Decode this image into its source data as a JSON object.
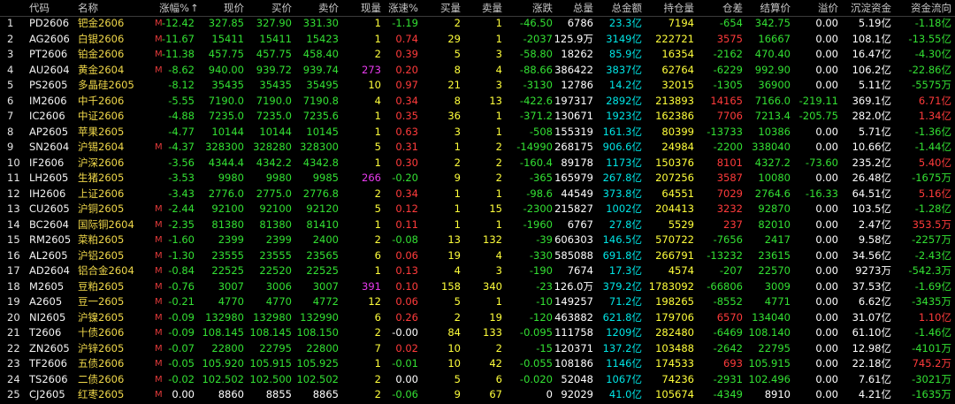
{
  "colors": {
    "up": "#ff3b3b",
    "down": "#33e033",
    "neutral": "#ffffff",
    "code": "#f2f2f2",
    "name": "#f0d84a",
    "cyan": "#00e5e5",
    "yellow": "#ffff3b",
    "volume_purple": "#e83aee",
    "m_mark": "#e23a3a"
  },
  "header": {
    "columns": [
      "",
      "代码",
      "名称",
      "",
      "涨幅%",
      "现价",
      "买价",
      "卖价",
      "现量",
      "涨速%",
      "买量",
      "卖量",
      "涨跌",
      "总量",
      "总金额",
      "持仓量",
      "仓差",
      "结算价",
      "溢价",
      "沉淀资金",
      "资金流向"
    ],
    "sort_indicator": "↑"
  },
  "rows": [
    {
      "idx": "1",
      "code": "PD2606",
      "name": "钯金2606",
      "mark": "M",
      "chg": "-12.42",
      "price": "327.85",
      "bid": "327.90",
      "ask": "331.30",
      "curvol": "1",
      "speed": "-1.19",
      "bidvol": "2",
      "askvol": "1",
      "diff": "-46.50",
      "vol": "6786",
      "amount": "23.3亿",
      "oi": "7194",
      "oidiff": "-654",
      "settle": "342.75",
      "premium": "0.00",
      "sunk": "5.19亿",
      "flow": "-1.18亿"
    },
    {
      "idx": "2",
      "code": "AG2606",
      "name": "白银2606",
      "mark": "M",
      "chg": "-11.67",
      "price": "15411",
      "bid": "15411",
      "ask": "15423",
      "curvol": "1",
      "speed": "0.74",
      "bidvol": "29",
      "askvol": "1",
      "diff": "-2037",
      "vol": "125.9万",
      "amount": "3149亿",
      "oi": "222721",
      "oidiff": "3575",
      "settle": "16667",
      "premium": "0.00",
      "sunk": "108.1亿",
      "flow": "-13.55亿"
    },
    {
      "idx": "3",
      "code": "PT2606",
      "name": "铂金2606",
      "mark": "M",
      "chg": "-11.38",
      "price": "457.75",
      "bid": "457.75",
      "ask": "458.40",
      "curvol": "2",
      "speed": "0.39",
      "bidvol": "5",
      "askvol": "3",
      "diff": "-58.80",
      "vol": "18262",
      "amount": "85.9亿",
      "oi": "16354",
      "oidiff": "-2162",
      "settle": "470.40",
      "premium": "0.00",
      "sunk": "16.47亿",
      "flow": "-4.30亿"
    },
    {
      "idx": "4",
      "code": "AU2604",
      "name": "黄金2604",
      "mark": "M",
      "chg": "-8.62",
      "price": "940.00",
      "bid": "939.72",
      "ask": "939.74",
      "curvol": "273",
      "speed": "0.20",
      "bidvol": "8",
      "askvol": "4",
      "diff": "-88.66",
      "vol": "386422",
      "amount": "3837亿",
      "oi": "62764",
      "oidiff": "-6229",
      "settle": "992.90",
      "premium": "0.00",
      "sunk": "106.2亿",
      "flow": "-22.86亿"
    },
    {
      "idx": "5",
      "code": "PS2605",
      "name": "多晶硅2605",
      "mark": "",
      "chg": "-8.12",
      "price": "35435",
      "bid": "35435",
      "ask": "35495",
      "curvol": "10",
      "speed": "0.97",
      "bidvol": "21",
      "askvol": "3",
      "diff": "-3130",
      "vol": "12786",
      "amount": "14.2亿",
      "oi": "32015",
      "oidiff": "-1305",
      "settle": "36900",
      "premium": "0.00",
      "sunk": "5.11亿",
      "flow": "-5575万"
    },
    {
      "idx": "6",
      "code": "IM2606",
      "name": "中千2606",
      "mark": "",
      "chg": "-5.55",
      "price": "7190.0",
      "bid": "7190.0",
      "ask": "7190.8",
      "curvol": "4",
      "speed": "0.34",
      "bidvol": "8",
      "askvol": "13",
      "diff": "-422.6",
      "vol": "197317",
      "amount": "2892亿",
      "oi": "213893",
      "oidiff": "14165",
      "settle": "7166.0",
      "premium": "-219.11",
      "sunk": "369.1亿",
      "flow": "6.71亿"
    },
    {
      "idx": "7",
      "code": "IC2606",
      "name": "中证2606",
      "mark": "",
      "chg": "-4.88",
      "price": "7235.0",
      "bid": "7235.0",
      "ask": "7235.6",
      "curvol": "1",
      "speed": "0.35",
      "bidvol": "36",
      "askvol": "1",
      "diff": "-371.2",
      "vol": "130671",
      "amount": "1923亿",
      "oi": "162386",
      "oidiff": "7706",
      "settle": "7213.4",
      "premium": "-205.75",
      "sunk": "282.0亿",
      "flow": "1.34亿"
    },
    {
      "idx": "8",
      "code": "AP2605",
      "name": "苹果2605",
      "mark": "",
      "chg": "-4.77",
      "price": "10144",
      "bid": "10144",
      "ask": "10145",
      "curvol": "1",
      "speed": "0.63",
      "bidvol": "3",
      "askvol": "1",
      "diff": "-508",
      "vol": "155319",
      "amount": "161.3亿",
      "oi": "80399",
      "oidiff": "-13733",
      "settle": "10386",
      "premium": "0.00",
      "sunk": "5.71亿",
      "flow": "-1.36亿"
    },
    {
      "idx": "9",
      "code": "SN2604",
      "name": "沪锡2604",
      "mark": "M",
      "chg": "-4.37",
      "price": "328300",
      "bid": "328280",
      "ask": "328300",
      "curvol": "5",
      "speed": "0.31",
      "bidvol": "1",
      "askvol": "2",
      "diff": "-14990",
      "vol": "268175",
      "amount": "906.6亿",
      "oi": "24984",
      "oidiff": "-2200",
      "settle": "338040",
      "premium": "0.00",
      "sunk": "10.66亿",
      "flow": "-1.44亿"
    },
    {
      "idx": "10",
      "code": "IF2606",
      "name": "沪深2606",
      "mark": "",
      "chg": "-3.56",
      "price": "4344.4",
      "bid": "4342.2",
      "ask": "4342.8",
      "curvol": "1",
      "speed": "0.30",
      "bidvol": "2",
      "askvol": "2",
      "diff": "-160.4",
      "vol": "89178",
      "amount": "1173亿",
      "oi": "150376",
      "oidiff": "8101",
      "settle": "4327.2",
      "premium": "-73.60",
      "sunk": "235.2亿",
      "flow": "5.40亿"
    },
    {
      "idx": "11",
      "code": "LH2605",
      "name": "生猪2605",
      "mark": "",
      "chg": "-3.53",
      "price": "9980",
      "bid": "9980",
      "ask": "9985",
      "curvol": "266",
      "speed": "-0.20",
      "bidvol": "9",
      "askvol": "2",
      "diff": "-365",
      "vol": "165979",
      "amount": "267.8亿",
      "oi": "207256",
      "oidiff": "3587",
      "settle": "10080",
      "premium": "0.00",
      "sunk": "26.48亿",
      "flow": "-1675万"
    },
    {
      "idx": "12",
      "code": "IH2606",
      "name": "上证2606",
      "mark": "",
      "chg": "-3.43",
      "price": "2776.0",
      "bid": "2775.0",
      "ask": "2776.8",
      "curvol": "2",
      "speed": "0.34",
      "bidvol": "1",
      "askvol": "1",
      "diff": "-98.6",
      "vol": "44549",
      "amount": "373.8亿",
      "oi": "64551",
      "oidiff": "7029",
      "settle": "2764.6",
      "premium": "-16.33",
      "sunk": "64.51亿",
      "flow": "5.16亿"
    },
    {
      "idx": "13",
      "code": "CU2605",
      "name": "沪铜2605",
      "mark": "M",
      "chg": "-2.44",
      "price": "92100",
      "bid": "92100",
      "ask": "92120",
      "curvol": "5",
      "speed": "0.12",
      "bidvol": "1",
      "askvol": "15",
      "diff": "-2300",
      "vol": "215827",
      "amount": "1002亿",
      "oi": "204413",
      "oidiff": "3232",
      "settle": "92870",
      "premium": "0.00",
      "sunk": "103.5亿",
      "flow": "-1.28亿"
    },
    {
      "idx": "14",
      "code": "BC2604",
      "name": "国际铜2604",
      "mark": "M",
      "chg": "-2.35",
      "price": "81380",
      "bid": "81380",
      "ask": "81410",
      "curvol": "1",
      "speed": "0.11",
      "bidvol": "1",
      "askvol": "1",
      "diff": "-1960",
      "vol": "6767",
      "amount": "27.8亿",
      "oi": "5529",
      "oidiff": "237",
      "settle": "82010",
      "premium": "0.00",
      "sunk": "2.47亿",
      "flow": "353.5万"
    },
    {
      "idx": "15",
      "code": "RM2605",
      "name": "菜粕2605",
      "mark": "M",
      "chg": "-1.60",
      "price": "2399",
      "bid": "2399",
      "ask": "2400",
      "curvol": "2",
      "speed": "-0.08",
      "bidvol": "13",
      "askvol": "132",
      "diff": "-39",
      "vol": "606303",
      "amount": "146.5亿",
      "oi": "570722",
      "oidiff": "-7656",
      "settle": "2417",
      "premium": "0.00",
      "sunk": "9.58亿",
      "flow": "-2257万"
    },
    {
      "idx": "16",
      "code": "AL2605",
      "name": "沪铝2605",
      "mark": "M",
      "chg": "-1.30",
      "price": "23555",
      "bid": "23555",
      "ask": "23565",
      "curvol": "6",
      "speed": "0.06",
      "bidvol": "19",
      "askvol": "4",
      "diff": "-330",
      "vol": "585088",
      "amount": "691.8亿",
      "oi": "266791",
      "oidiff": "-13232",
      "settle": "23615",
      "premium": "0.00",
      "sunk": "34.56亿",
      "flow": "-2.43亿"
    },
    {
      "idx": "17",
      "code": "AD2604",
      "name": "铝合金2604",
      "mark": "M",
      "chg": "-0.84",
      "price": "22525",
      "bid": "22520",
      "ask": "22525",
      "curvol": "1",
      "speed": "0.13",
      "bidvol": "4",
      "askvol": "3",
      "diff": "-190",
      "vol": "7674",
      "amount": "17.3亿",
      "oi": "4574",
      "oidiff": "-207",
      "settle": "22570",
      "premium": "0.00",
      "sunk": "9273万",
      "flow": "-542.3万"
    },
    {
      "idx": "18",
      "code": "M2605",
      "name": "豆粕2605",
      "mark": "M",
      "chg": "-0.76",
      "price": "3007",
      "bid": "3006",
      "ask": "3007",
      "curvol": "391",
      "speed": "0.10",
      "bidvol": "158",
      "askvol": "340",
      "diff": "-23",
      "vol": "126.0万",
      "amount": "379.2亿",
      "oi": "1783092",
      "oidiff": "-66806",
      "settle": "3009",
      "premium": "0.00",
      "sunk": "37.53亿",
      "flow": "-1.69亿"
    },
    {
      "idx": "19",
      "code": "A2605",
      "name": "豆一2605",
      "mark": "M",
      "chg": "-0.21",
      "price": "4770",
      "bid": "4770",
      "ask": "4772",
      "curvol": "12",
      "speed": "0.06",
      "bidvol": "5",
      "askvol": "1",
      "diff": "-10",
      "vol": "149257",
      "amount": "71.2亿",
      "oi": "198265",
      "oidiff": "-8552",
      "settle": "4771",
      "premium": "0.00",
      "sunk": "6.62亿",
      "flow": "-3435万"
    },
    {
      "idx": "20",
      "code": "NI2605",
      "name": "沪镍2605",
      "mark": "M",
      "chg": "-0.09",
      "price": "132980",
      "bid": "132980",
      "ask": "132990",
      "curvol": "6",
      "speed": "0.26",
      "bidvol": "2",
      "askvol": "19",
      "diff": "-120",
      "vol": "463882",
      "amount": "621.8亿",
      "oi": "179706",
      "oidiff": "6570",
      "settle": "134040",
      "premium": "0.00",
      "sunk": "31.07亿",
      "flow": "1.10亿"
    },
    {
      "idx": "21",
      "code": "T2606",
      "name": "十债2606",
      "mark": "M",
      "chg": "-0.09",
      "price": "108.145",
      "bid": "108.145",
      "ask": "108.150",
      "curvol": "2",
      "speed": "-0.00",
      "bidvol": "84",
      "askvol": "133",
      "diff": "-0.095",
      "vol": "111758",
      "amount": "1209亿",
      "oi": "282480",
      "oidiff": "-6469",
      "settle": "108.140",
      "premium": "0.00",
      "sunk": "61.10亿",
      "flow": "-1.46亿"
    },
    {
      "idx": "22",
      "code": "ZN2605",
      "name": "沪锌2605",
      "mark": "M",
      "chg": "-0.07",
      "price": "22800",
      "bid": "22795",
      "ask": "22800",
      "curvol": "7",
      "speed": "0.02",
      "bidvol": "10",
      "askvol": "2",
      "diff": "-15",
      "vol": "120371",
      "amount": "137.2亿",
      "oi": "103488",
      "oidiff": "-2642",
      "settle": "22795",
      "premium": "0.00",
      "sunk": "12.98亿",
      "flow": "-4101万"
    },
    {
      "idx": "23",
      "code": "TF2606",
      "name": "五债2606",
      "mark": "M",
      "chg": "-0.05",
      "price": "105.920",
      "bid": "105.915",
      "ask": "105.925",
      "curvol": "1",
      "speed": "-0.01",
      "bidvol": "10",
      "askvol": "42",
      "diff": "-0.055",
      "vol": "108186",
      "amount": "1146亿",
      "oi": "174533",
      "oidiff": "693",
      "settle": "105.915",
      "premium": "0.00",
      "sunk": "22.18亿",
      "flow": "745.2万"
    },
    {
      "idx": "24",
      "code": "TS2606",
      "name": "二债2606",
      "mark": "M",
      "chg": "-0.02",
      "price": "102.502",
      "bid": "102.500",
      "ask": "102.502",
      "curvol": "2",
      "speed": "0.00",
      "bidvol": "5",
      "askvol": "6",
      "diff": "-0.020",
      "vol": "52048",
      "amount": "1067亿",
      "oi": "74236",
      "oidiff": "-2931",
      "settle": "102.496",
      "premium": "0.00",
      "sunk": "7.61亿",
      "flow": "-3021万"
    },
    {
      "idx": "25",
      "code": "CJ2605",
      "name": "红枣2605",
      "mark": "M",
      "chg": "0.00",
      "price": "8860",
      "bid": "8855",
      "ask": "8865",
      "curvol": "2",
      "speed": "-0.06",
      "bidvol": "9",
      "askvol": "67",
      "diff": "0",
      "vol": "92029",
      "amount": "41.0亿",
      "oi": "105674",
      "oidiff": "-4349",
      "settle": "8910",
      "premium": "0.00",
      "sunk": "4.21亿",
      "flow": "-1635万"
    }
  ]
}
